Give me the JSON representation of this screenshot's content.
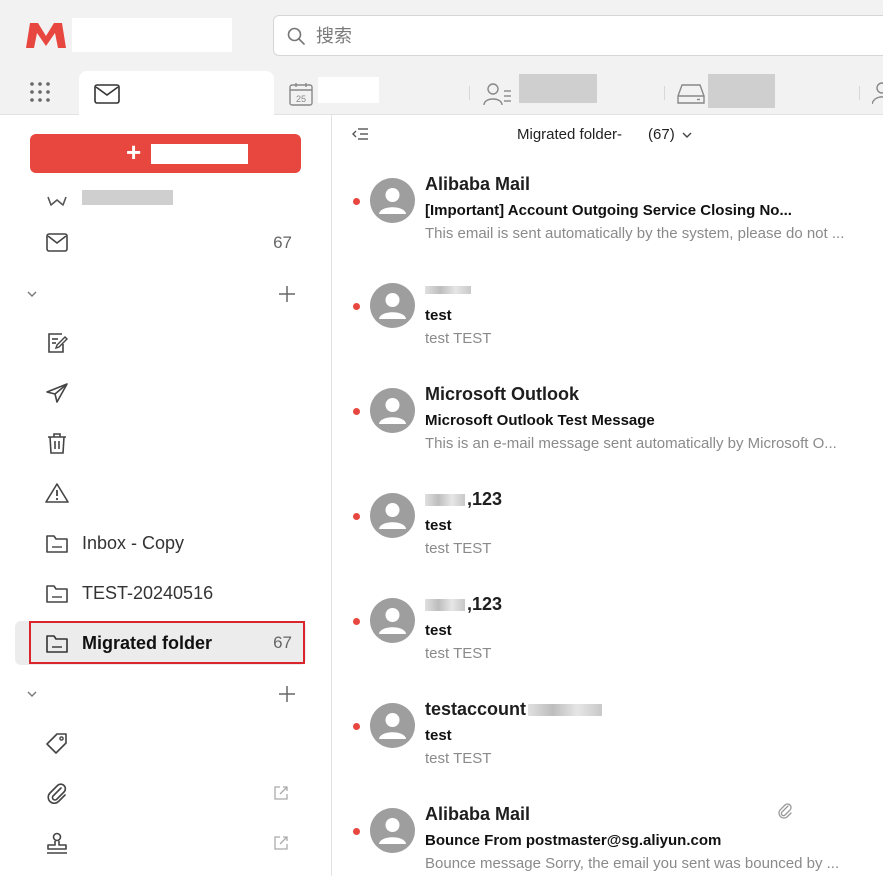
{
  "header": {
    "search_placeholder": "搜索",
    "calendar_day": "25",
    "colors": {
      "brand": "#e8473f",
      "topbar_bg": "#f2f2f2"
    }
  },
  "sidebar": {
    "inbox_count": "67",
    "folders": [
      {
        "label": "Inbox - Copy",
        "icon": "folder-icon"
      },
      {
        "label": "TEST-20240516",
        "icon": "folder-icon"
      },
      {
        "label": "Migrated folder",
        "icon": "folder-icon",
        "count": "67",
        "selected": true
      }
    ]
  },
  "list": {
    "folder_title_prefix": "Migrated folder-",
    "folder_title_count": "(67)",
    "messages": [
      {
        "sender": "Alibaba Mail",
        "subject": "[Important] Account Outgoing Service Closing No...",
        "preview": "This email is sent automatically by the system, please do not ...",
        "unread": true
      },
      {
        "sender": "",
        "subject": "test",
        "preview": "test TEST",
        "unread": true
      },
      {
        "sender": "Microsoft Outlook",
        "subject": "Microsoft Outlook Test Message",
        "preview": "This is an e-mail message sent automatically by Microsoft O...",
        "unread": true
      },
      {
        "sender": ",123",
        "subject": "test",
        "preview": "test TEST",
        "unread": true
      },
      {
        "sender": ",123",
        "subject": "test",
        "preview": "test TEST",
        "unread": true
      },
      {
        "sender": "testaccount",
        "subject": "test",
        "preview": "test TEST",
        "unread": true
      },
      {
        "sender": "Alibaba Mail",
        "subject": "Bounce From postmaster@sg.aliyun.com",
        "preview": "Bounce message Sorry, the email you sent was bounced by ...",
        "unread": true,
        "has_attachment": true
      }
    ]
  }
}
